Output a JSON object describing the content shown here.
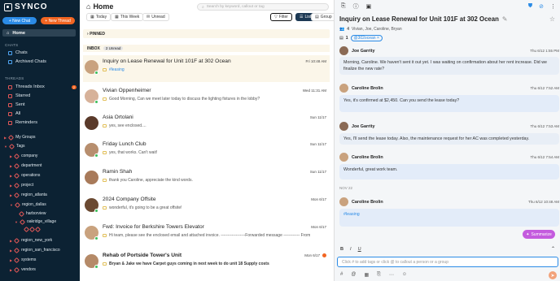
{
  "app": {
    "name": "SYNCO"
  },
  "sidebar": {
    "new_chat": "+ New Chat",
    "new_thread": "+ New Thread",
    "home": "Home",
    "chats_heading": "CHATS",
    "chats": [
      {
        "label": "Chats"
      },
      {
        "label": "Archived Chats"
      }
    ],
    "threads_heading": "THREADS",
    "threads": [
      {
        "label": "Threads Inbox",
        "count": "2"
      },
      {
        "label": "Starred"
      },
      {
        "label": "Sent"
      },
      {
        "label": "All"
      },
      {
        "label": "Reminders"
      }
    ],
    "groups": [
      {
        "label": "My Groups"
      },
      {
        "label": "Tags"
      }
    ],
    "tags": [
      {
        "label": "company"
      },
      {
        "label": "department"
      },
      {
        "label": "operations"
      },
      {
        "label": "project"
      },
      {
        "label": "region_atlanta"
      },
      {
        "label": "region_dallas"
      },
      {
        "label": "harborview"
      },
      {
        "label": "oakridge_village"
      },
      {
        "label": "region_new_york"
      },
      {
        "label": "region_san_francisco"
      },
      {
        "label": "systems"
      },
      {
        "label": "vendors"
      }
    ]
  },
  "main": {
    "title": "Home",
    "search_placeholder": "Search by keyword, callout or tag",
    "filters": {
      "today": "Today",
      "this_week": "This Week",
      "unread": "Unread"
    },
    "view": {
      "filter": "Filter",
      "list": "List",
      "group": "Group"
    },
    "pinned": "PINNED",
    "inbox": "INBOX",
    "unread_badge": "2 Unread",
    "threads": [
      {
        "subject": "Inquiry on Lease Renewal for Unit 101F at 302 Ocean",
        "date": "Fri 10:48 AM",
        "snippet": "#leasing",
        "avatar_color": "#c9a27e"
      },
      {
        "subject": "Vivian Oppenheimer",
        "date": "Wed 11:31 AM",
        "snippet": "Good Morning, Can we meet later today to discuss the lighting fixtures in the lobby?",
        "avatar_color": "#d7b29a"
      },
      {
        "subject": "Asia Ortolani",
        "date": "Sun 11/17",
        "snippet": "yes, see enclosed....",
        "avatar_color": "#5a3a2a"
      },
      {
        "subject": "Friday Lunch Club",
        "date": "Sun 11/17",
        "snippet": "yes, that works. Can't wait!",
        "avatar_color": "#b78e6e"
      },
      {
        "subject": "Ramin Shah",
        "date": "Sun 11/17",
        "snippet": "thank you Caroline, appreciate the kind words.",
        "avatar_color": "#a87a5a"
      },
      {
        "subject": "2024 Company Offsite",
        "date": "Mon 6/17",
        "snippet": "wonderful, it's going to be a great offsite!",
        "avatar_color": "#6b4a32"
      },
      {
        "subject": "Fwd: Invoice for Berkshire Towers Elevator",
        "date": "Mon 6/17",
        "snippet": "Hi team, please see the enclosed email and attached invoice. ------------------Forwarded message ------------ From",
        "avatar_color": "#c9a27e"
      },
      {
        "subject": "Rehab of Portside Tower's Unit",
        "date": "Mon 6/17",
        "snippet": "Bryan & Jake we have Carpet guys coming in next week to do unit 18 Supply costs",
        "avatar_color": "#b58a68"
      }
    ]
  },
  "detail": {
    "title": "Inquiry on Lease Renewal for Unit 101F at 302 Ocean",
    "participants_count": "4",
    "participants": "Vivian, Joe, Caroline, Bryan",
    "tag_count": "1",
    "tag": "@302ocean",
    "messages": [
      {
        "name": "Joe Garrity",
        "time": "Thu 6/12 1:55 PM",
        "text": "Morning, Caroline. We haven't sent it out yet. I was waiting on confirmation about her rent increase. Did we finalize the new rate?",
        "avatar_color": "#8a6a55"
      },
      {
        "name": "Caroline Brolin",
        "time": "Thu 6/12 7:52 AM",
        "text": "Yes, it's confirmed at $2,450. Can you send the lease today?",
        "avatar_color": "#c9a27e"
      },
      {
        "name": "Joe Garrity",
        "time": "Thu 6/12 7:53 AM",
        "text": "Yes, I'll send the lease today. Also, the maintenance request for her AC was completed yesterday.",
        "avatar_color": "#8a6a55"
      },
      {
        "name": "Caroline Brolin",
        "time": "Thu 6/12 7:54 AM",
        "text": "Wonderful, great work team.",
        "avatar_color": "#c9a27e"
      },
      {
        "name": "Caroline Brolin",
        "time": "Thu 6/12 10:48 AM",
        "text": "#leasing",
        "avatar_color": "#c9a27e"
      }
    ],
    "day_separator": "NOV 22",
    "summarize": "Summarize",
    "compose_placeholder": "Click # to add tags or click @ to callout a person or a group"
  }
}
